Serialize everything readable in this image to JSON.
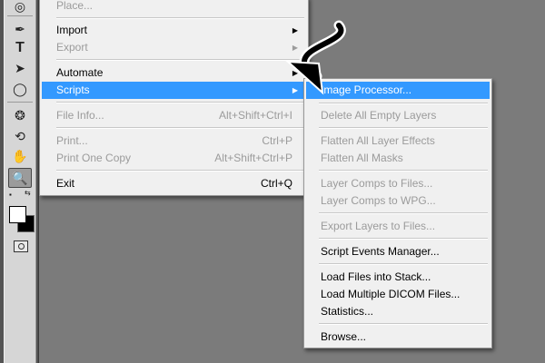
{
  "tools": [
    {
      "name": "lasso-tool-icon",
      "glyph": "◎"
    },
    {
      "name": "pen-tool-icon",
      "glyph": "✒"
    },
    {
      "name": "type-tool-icon",
      "glyph": "T"
    },
    {
      "name": "path-select-icon",
      "glyph": "➤"
    },
    {
      "name": "ellipse-tool-icon",
      "glyph": "◯"
    },
    {
      "name": "rotate-3d-icon",
      "glyph": "❂"
    },
    {
      "name": "orbit-3d-icon",
      "glyph": "⟲"
    },
    {
      "name": "hand-tool-icon",
      "glyph": "✋"
    },
    {
      "name": "zoom-tool-icon",
      "glyph": "🔍"
    }
  ],
  "main_menu": [
    {
      "label": "Place...",
      "enabled": false
    },
    {
      "label": "Import",
      "enabled": true,
      "submenu": true
    },
    {
      "label": "Export",
      "enabled": false,
      "submenu": true
    },
    {
      "label": "Automate",
      "enabled": true,
      "submenu": true
    },
    {
      "label": "Scripts",
      "enabled": true,
      "submenu": true,
      "highlighted": true
    },
    {
      "label": "File Info...",
      "enabled": false,
      "shortcut": "Alt+Shift+Ctrl+I"
    },
    {
      "label": "Print...",
      "enabled": false,
      "shortcut": "Ctrl+P"
    },
    {
      "label": "Print One Copy",
      "enabled": false,
      "shortcut": "Alt+Shift+Ctrl+P"
    },
    {
      "label": "Exit",
      "enabled": true,
      "shortcut": "Ctrl+Q"
    }
  ],
  "scripts_menu": [
    {
      "label": "Image Processor...",
      "enabled": true,
      "highlighted": true
    },
    {
      "label": "Delete All Empty Layers",
      "enabled": false
    },
    {
      "label": "Flatten All Layer Effects",
      "enabled": false
    },
    {
      "label": "Flatten All Masks",
      "enabled": false
    },
    {
      "label": "Layer Comps to Files...",
      "enabled": false
    },
    {
      "label": "Layer Comps to WPG...",
      "enabled": false
    },
    {
      "label": "Export Layers to Files...",
      "enabled": false
    },
    {
      "label": "Script Events Manager...",
      "enabled": true
    },
    {
      "label": "Load Files into Stack...",
      "enabled": true
    },
    {
      "label": "Load Multiple DICOM Files...",
      "enabled": true
    },
    {
      "label": "Statistics...",
      "enabled": true
    },
    {
      "label": "Browse...",
      "enabled": true
    }
  ],
  "colors": {
    "highlight": "#3399ff",
    "disabled_text": "#9b9b9b",
    "canvas": "#7b7b7b"
  }
}
